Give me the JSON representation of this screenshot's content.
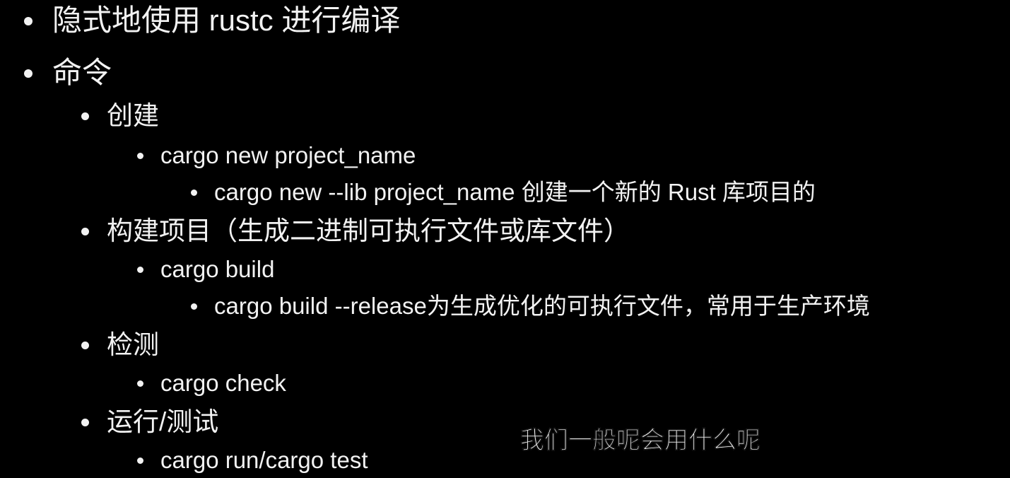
{
  "slide": {
    "items": [
      {
        "level": 1,
        "text": "隐式地使用 rustc 进行编译"
      },
      {
        "level": 1,
        "text": "命令"
      },
      {
        "level": 2,
        "text": "创建"
      },
      {
        "level": 3,
        "text": "cargo new project_name"
      },
      {
        "level": 4,
        "text": "cargo new --lib project_name 创建一个新的 Rust 库项目的"
      },
      {
        "level": 2,
        "text": "构建项目（生成二进制可执行文件或库文件）"
      },
      {
        "level": 3,
        "text": "cargo build"
      },
      {
        "level": 4,
        "text": "cargo build --release为生成优化的可执行文件，常用于生产环境"
      },
      {
        "level": 2,
        "text": "检测"
      },
      {
        "level": 3,
        "text": "cargo check"
      },
      {
        "level": 2,
        "text": "运行/测试"
      },
      {
        "level": 3,
        "text": "cargo run/cargo test"
      }
    ]
  },
  "subtitle": {
    "text": "我们一般呢会用什么呢"
  },
  "colors": {
    "background": "#000000",
    "text": "#f2f2f2",
    "subtitle": "#ffffff"
  }
}
